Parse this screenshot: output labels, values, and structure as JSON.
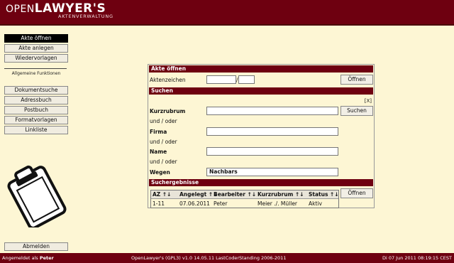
{
  "header": {
    "logo_light": "OPEN",
    "logo_bold": "LAWYER'S",
    "logo_sub": "AKTENVERWALTUNG"
  },
  "sidebar": {
    "top_items": [
      "Akte öffnen",
      "Akte anlegen",
      "Wiedervorlagen"
    ],
    "section_label": "Allgemeine Funktionen",
    "items": [
      "Dokumentsuche",
      "Adressbuch",
      "Postbuch",
      "Formatvorlagen",
      "Linkliste"
    ],
    "logout": "Abmelden"
  },
  "open_file": {
    "title": "Akte öffnen",
    "label": "Aktenzeichen",
    "separator": "/",
    "button": "Öffnen"
  },
  "search": {
    "title": "Suchen",
    "close": "[X]",
    "kurzrubrum_label": "Kurzrubrum",
    "button": "Suchen",
    "und_oder": "und / oder",
    "firma_label": "Firma",
    "name_label": "Name",
    "wegen_label": "Wegen",
    "wegen_value": "Nachbars"
  },
  "results": {
    "title": "Suchergebnisse",
    "columns": [
      "AZ ↑↓",
      "Angelegt ↑↓",
      "Bearbeiter ↑↓",
      "Kurzrubrum ↑↓",
      "Status ↑↓"
    ],
    "rows": [
      [
        "1-11",
        "07.06.2011",
        "Peter",
        "Meier ./. Müller",
        "Aktiv"
      ]
    ],
    "button": "Öffnen"
  },
  "footer": {
    "logged_in_prefix": "Angemeldet als",
    "user": "Peter",
    "center": "OpenLawyer's (GPL3) v1.0 14.05.11 LastCoderStanding 2006-2011",
    "right": "Di 07 Jun 2011 08:19:15 CEST"
  }
}
